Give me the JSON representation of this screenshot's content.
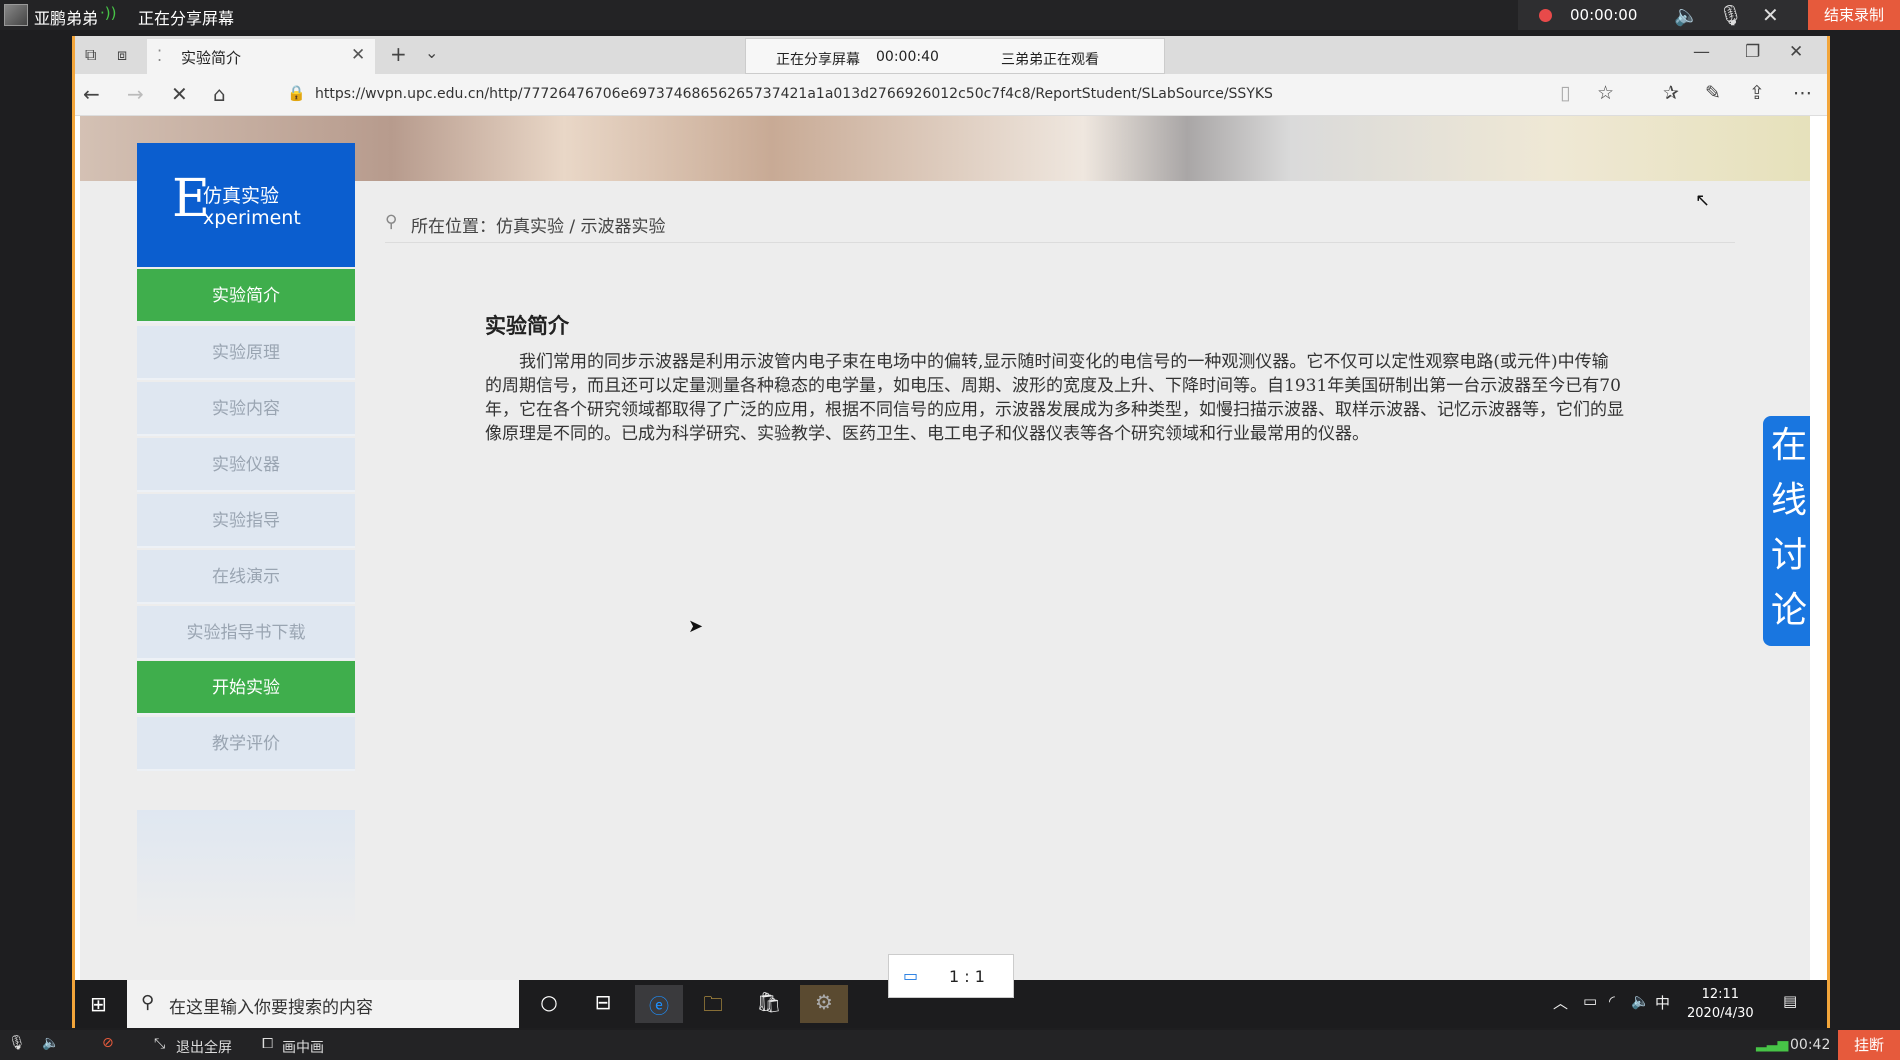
{
  "share_bar": {
    "user_name": "亚鹏弟弟",
    "sharing_status": "正在分享屏幕",
    "record_time": "00:00:00",
    "end_record_label": "结束录制"
  },
  "browser": {
    "tab_title": "实验简介",
    "share_indicator": {
      "label": "正在分享屏幕",
      "time": "00:00:40",
      "viewer": "三弟弟正在观看"
    },
    "url": "https://wvpn.upc.edu.cn/http/77726476706e69737468656265737421a1a013d2766926012c50c7f4c8/ReportStudent/SLabSource/SSYKS"
  },
  "page": {
    "logo": {
      "letter": "E",
      "line1": "仿真实验",
      "line2": "xperiment"
    },
    "sidebar": [
      {
        "label": "实验简介",
        "active": true
      },
      {
        "label": "实验原理",
        "active": false
      },
      {
        "label": "实验内容",
        "active": false
      },
      {
        "label": "实验仪器",
        "active": false
      },
      {
        "label": "实验指导",
        "active": false
      },
      {
        "label": "在线演示",
        "active": false
      },
      {
        "label": "实验指导书下载",
        "active": false
      },
      {
        "label": "开始实验",
        "active": true
      },
      {
        "label": "教学评价",
        "active": false
      }
    ],
    "breadcrumb": "所在位置：仿真实验 / 示波器实验",
    "article": {
      "title": "实验简介",
      "body": "我们常用的同步示波器是利用示波管内电子束在电场中的偏转,显示随时间变化的电信号的一种观测仪器。它不仅可以定性观察电路(或元件)中传输的周期信号，而且还可以定量测量各种稳态的电学量，如电压、周期、波形的宽度及上升、下降时间等。自1931年美国研制出第一台示波器至今已有70年，它在各个研究领域都取得了广泛的应用，根据不同信号的应用，示波器发展成为多种类型，如慢扫描示波器、取样示波器、记忆示波器等，它们的显像原理是不同的。已成为科学研究、实验教学、医药卫生、电工电子和仪器仪表等各个研究领域和行业最常用的仪器。"
    },
    "discussion_tab": [
      "在",
      "线",
      "讨",
      "论"
    ]
  },
  "taskbar": {
    "search_placeholder": "在这里输入你要搜索的内容",
    "ime": "中",
    "time": "12:11",
    "date": "2020/4/30"
  },
  "ratio_label": "1 : 1",
  "bottom_bar": {
    "exit_fullscreen": "退出全屏",
    "pip": "画中画",
    "elapsed": "00:42",
    "hangup": "挂断"
  },
  "colors": {
    "accent_green": "#3fae4c",
    "logo_blue": "#0b5ecf",
    "discussion_blue": "#1976e0",
    "record_red": "#e65a3c"
  }
}
